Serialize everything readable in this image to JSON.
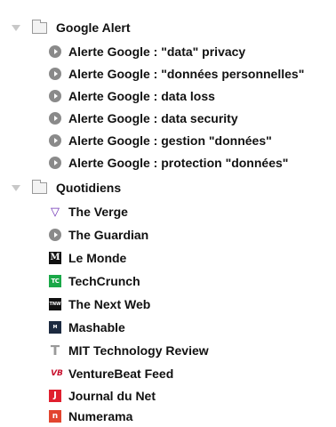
{
  "folders": [
    {
      "name": "Google Alert",
      "feeds": [
        {
          "label": "Alerte Google : \"data\" privacy",
          "icon": "feed-generic-icon"
        },
        {
          "label": "Alerte Google : \"données personnelles\"",
          "icon": "feed-generic-icon"
        },
        {
          "label": "Alerte Google : data loss",
          "icon": "feed-generic-icon"
        },
        {
          "label": "Alerte Google : data security",
          "icon": "feed-generic-icon"
        },
        {
          "label": "Alerte Google : gestion \"données\"",
          "icon": "feed-generic-icon"
        },
        {
          "label": "Alerte Google : protection \"données\"",
          "icon": "feed-generic-icon"
        }
      ]
    },
    {
      "name": "Quotidiens",
      "feeds": [
        {
          "label": "The Verge",
          "icon": "the-verge-icon",
          "glyph": "▽"
        },
        {
          "label": "The Guardian",
          "icon": "feed-generic-icon"
        },
        {
          "label": "Le Monde",
          "icon": "le-monde-icon",
          "glyph": "M"
        },
        {
          "label": "TechCrunch",
          "icon": "techcrunch-icon",
          "glyph": "TC"
        },
        {
          "label": "The Next Web",
          "icon": "the-next-web-icon",
          "glyph": "TNW"
        },
        {
          "label": "Mashable",
          "icon": "mashable-icon",
          "glyph": "M"
        },
        {
          "label": "MIT Technology Review",
          "icon": "mit-technology-review-icon",
          "glyph": "T"
        },
        {
          "label": "VentureBeat Feed",
          "icon": "venturebeat-icon",
          "glyph": "VB"
        },
        {
          "label": "Journal du Net",
          "icon": "journal-du-net-icon",
          "glyph": "J"
        },
        {
          "label": "Numerama",
          "icon": "numerama-icon",
          "glyph": "n"
        }
      ]
    }
  ],
  "colors": {
    "text": "#111111",
    "expander": "#c8c8c8",
    "generic_favicon": "#8a8a8a",
    "verge": "#6b2fb3",
    "techcrunch": "#1aa848",
    "venturebeat": "#c8102e",
    "journal_du_net": "#e0202f",
    "numerama": "#e2452f"
  }
}
